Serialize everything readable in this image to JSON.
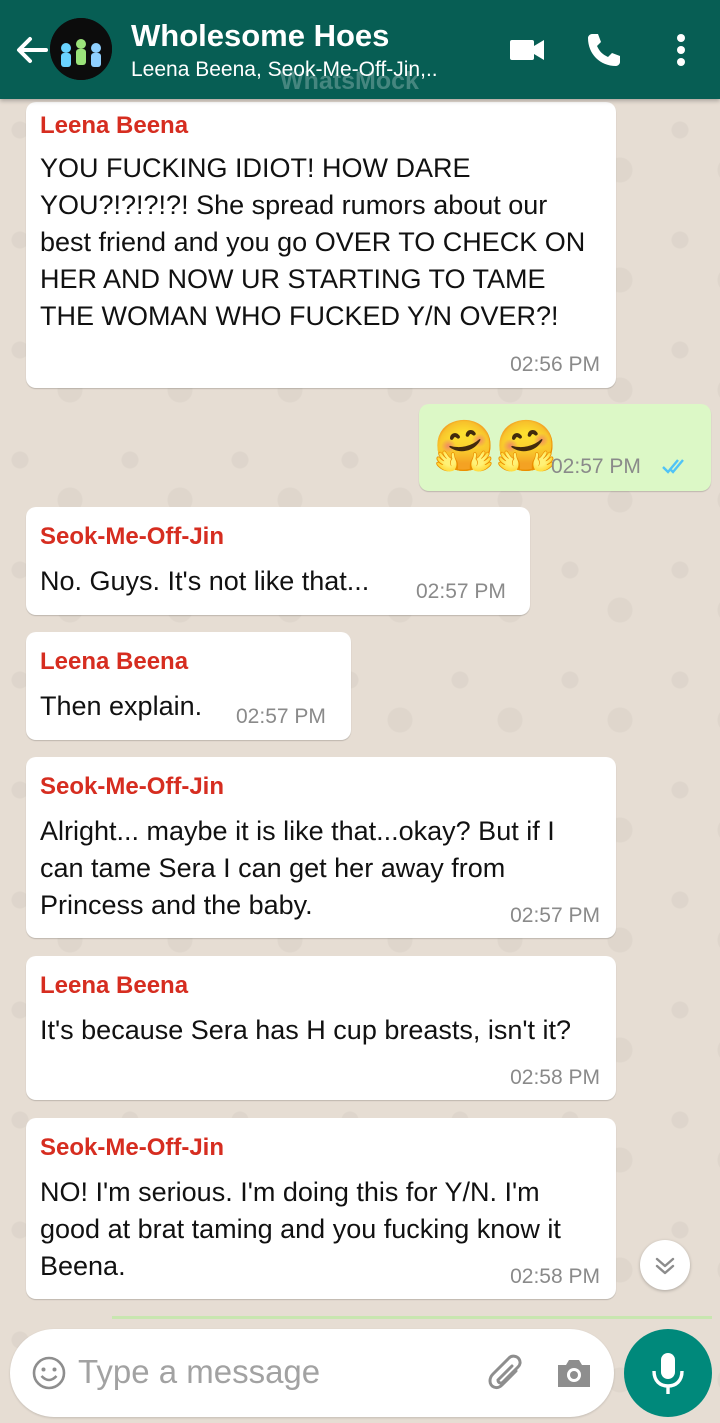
{
  "header": {
    "title": "Wholesome Hoes",
    "subtitle": "Leena Beena, Seok-Me-Off-Jin,..",
    "watermark": "WhatsMock",
    "icons": [
      "back-arrow-icon",
      "video-call-icon",
      "phone-icon",
      "more-vertical-icon"
    ]
  },
  "messages": [
    {
      "sender": "Leena Beena",
      "text": "YOU FUCKING IDIOT! HOW DARE YOU?!?!?!?! She spread rumors about our best friend and you go OVER TO CHECK ON HER AND NOW UR STARTING TO TAME THE WOMAN WHO FUCKED Y/N OVER?!",
      "time": "02:56 PM"
    },
    {
      "sender": "",
      "text": "🤗🤗",
      "time": "02:57 PM",
      "outgoing": true,
      "status": "read"
    },
    {
      "sender": "Seok-Me-Off-Jin",
      "text": "No. Guys. It's not like that...",
      "time": "02:57 PM"
    },
    {
      "sender": "Leena Beena",
      "text": "Then explain.",
      "time": "02:57 PM"
    },
    {
      "sender": "Seok-Me-Off-Jin",
      "text": "Alright... maybe it is like that...okay? But if I can tame Sera I can get her away from Princess and the baby.",
      "time": "02:57 PM"
    },
    {
      "sender": "Leena Beena",
      "text": "It's because Sera has H cup breasts, isn't it?",
      "time": "02:58 PM"
    },
    {
      "sender": "Seok-Me-Off-Jin",
      "text": "NO! I'm serious. I'm doing this for Y/N. I'm good at brat taming and you fucking know it Beena.",
      "time": "02:58 PM"
    }
  ],
  "composer": {
    "placeholder": "Type a message",
    "icons": [
      "emoji-icon",
      "attach-icon",
      "camera-icon",
      "mic-icon"
    ]
  },
  "colors": {
    "header": "#075e54",
    "sender_name": "#d62d20",
    "outgoing_bubble": "#dcf8c6",
    "read_ticks": "#4fc3f7",
    "mic_button": "#00897b"
  }
}
